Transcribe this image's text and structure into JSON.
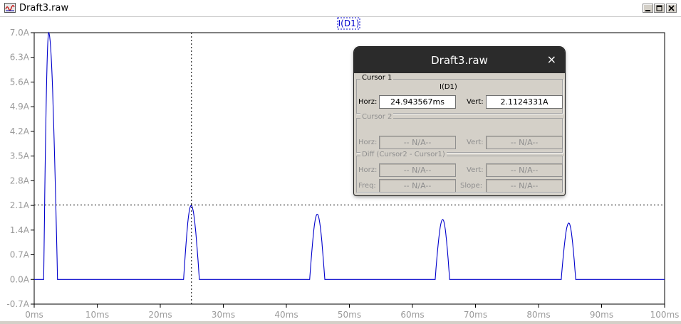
{
  "window": {
    "title": "Draft3.raw"
  },
  "colors": {
    "trace": "#0000cc",
    "axis_text": "#9a9a9a",
    "cursor": "#000000",
    "label_box": "#0000cc"
  },
  "chart_data": {
    "type": "line",
    "trace_label": "I(D1)",
    "xlabel": "",
    "ylabel": "",
    "xlim": [
      0,
      100
    ],
    "ylim": [
      -0.7,
      7.0
    ],
    "x_ticks": [
      "0ms",
      "10ms",
      "20ms",
      "30ms",
      "40ms",
      "50ms",
      "60ms",
      "70ms",
      "80ms",
      "90ms",
      "100ms"
    ],
    "y_ticks": [
      "7.0A",
      "6.3A",
      "5.6A",
      "4.9A",
      "4.2A",
      "3.5A",
      "2.8A",
      "2.1A",
      "1.4A",
      "0.7A",
      "0.0A",
      "-0.7A"
    ],
    "grid": false,
    "series": [
      {
        "name": "I(D1)",
        "pulses": [
          {
            "start_ms": 1.5,
            "peak_ms": 2.3,
            "end_ms": 3.7,
            "peak_A": 7.0
          },
          {
            "start_ms": 23.7,
            "peak_ms": 24.9,
            "end_ms": 26.2,
            "peak_A": 2.1
          },
          {
            "start_ms": 43.7,
            "peak_ms": 44.9,
            "end_ms": 46.1,
            "peak_A": 1.85
          },
          {
            "start_ms": 63.6,
            "peak_ms": 64.8,
            "end_ms": 65.9,
            "peak_A": 1.7
          },
          {
            "start_ms": 83.6,
            "peak_ms": 84.8,
            "end_ms": 85.9,
            "peak_A": 1.6
          }
        ]
      }
    ],
    "cursor": {
      "x_ms": 24.943567,
      "y_A": 2.1124331
    }
  },
  "dialog": {
    "title": "Draft3.raw",
    "close": "×",
    "cursor1": {
      "legend": "Cursor 1",
      "trace": "I(D1)",
      "horz_label": "Horz:",
      "horz_value": "24.943567ms",
      "vert_label": "Vert:",
      "vert_value": "2.1124331A"
    },
    "cursor2": {
      "legend": "Cursor 2",
      "horz_label": "Horz:",
      "horz_value": "-- N/A--",
      "vert_label": "Vert:",
      "vert_value": "-- N/A--"
    },
    "diff": {
      "legend": "Diff (Cursor2 - Cursor1)",
      "horz_label": "Horz:",
      "horz_value": "-- N/A--",
      "vert_label": "Vert:",
      "vert_value": "-- N/A--",
      "freq_label": "Freq:",
      "freq_value": "-- N/A--",
      "slope_label": "Slope:",
      "slope_value": "-- N/A--"
    }
  }
}
